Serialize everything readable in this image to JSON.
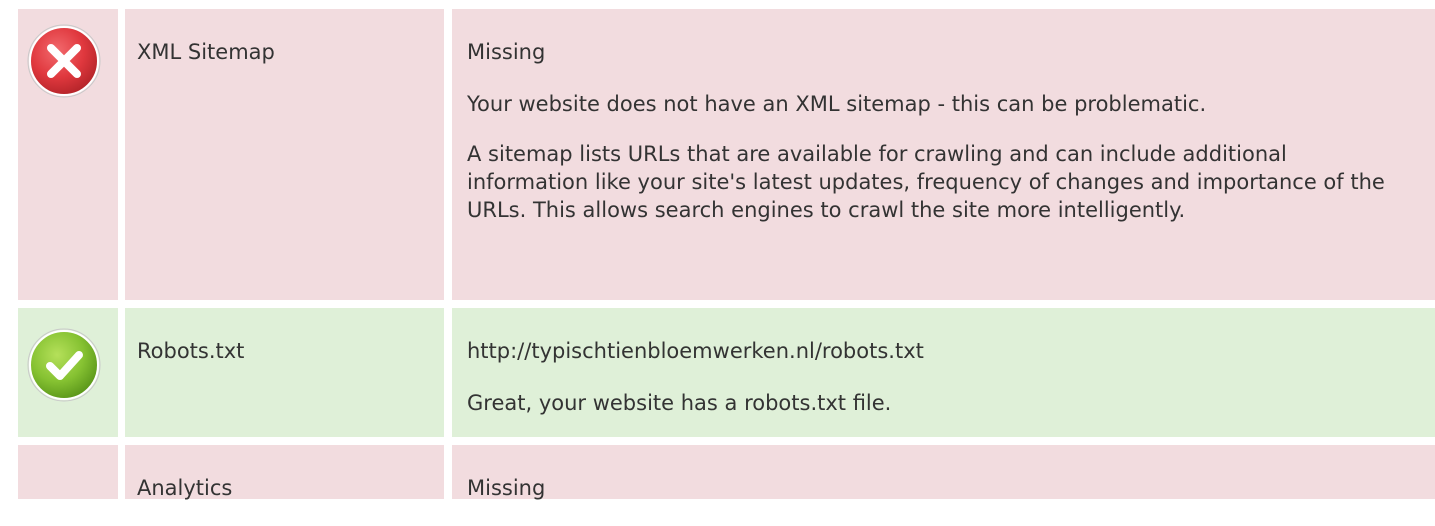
{
  "rows": [
    {
      "status": "fail",
      "icon": "error-x-icon",
      "label": "XML Sitemap",
      "value": "Missing",
      "message": "Your website does not have an XML sitemap - this can be problematic.",
      "explanation": "A sitemap lists URLs that are available for crawling and can include additional information like your site's latest updates, frequency of changes and importance of the URLs. This allows search engines to crawl the site more intelligently."
    },
    {
      "status": "pass",
      "icon": "success-check-icon",
      "label": "Robots.txt",
      "value": "http://typischtienbloemwerken.nl/robots.txt",
      "message": "Great, your website has a robots.txt file."
    },
    {
      "status": "fail",
      "label": "Analytics",
      "value": "Missing"
    }
  ],
  "colors": {
    "fail_background": "#f2dcdf",
    "pass_background": "#dff0d8",
    "error_red": "#e0383e",
    "success_green": "#86c232",
    "text": "#333333"
  }
}
